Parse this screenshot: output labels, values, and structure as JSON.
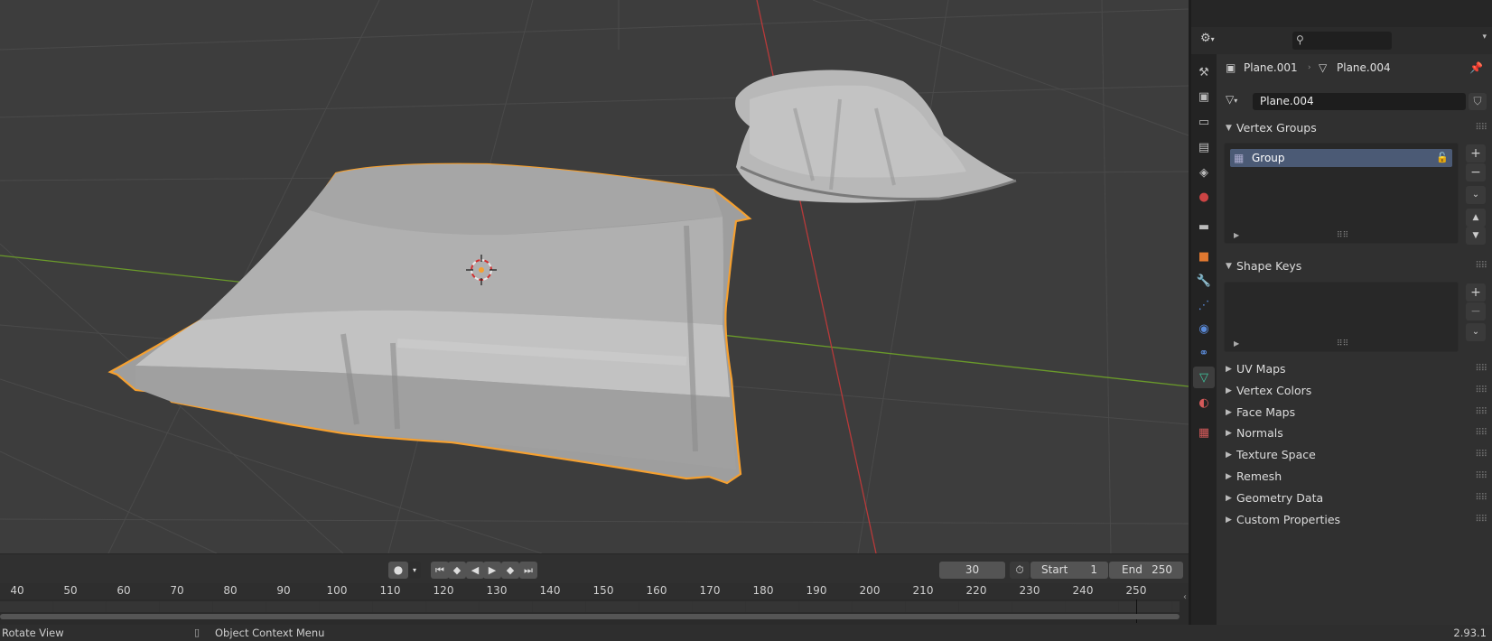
{
  "header": {
    "search_placeholder": ""
  },
  "breadcrumb": {
    "object": "Plane.001",
    "mesh": "Plane.004"
  },
  "datablock": {
    "name": "Plane.004"
  },
  "panels": {
    "vertex_groups": {
      "title": "Vertex Groups",
      "items": [
        "Group"
      ]
    },
    "shape_keys": {
      "title": "Shape Keys"
    },
    "collapsed": [
      "UV Maps",
      "Vertex Colors",
      "Face Maps",
      "Normals",
      "Texture Space",
      "Remesh",
      "Geometry Data",
      "Custom Properties"
    ]
  },
  "timeline": {
    "current_frame": "30",
    "start_label": "Start",
    "start_value": "1",
    "end_label": "End",
    "end_value": "250",
    "ruler": [
      "40",
      "50",
      "60",
      "70",
      "80",
      "90",
      "100",
      "110",
      "120",
      "130",
      "140",
      "150",
      "160",
      "170",
      "180",
      "190",
      "200",
      "210",
      "220",
      "230",
      "240",
      "250"
    ]
  },
  "statusbar": {
    "left": "Rotate View",
    "middle": "Object Context Menu",
    "version": "2.93.1"
  },
  "colors": {
    "selection_outline": "#f5a030",
    "x_axis": "#b83a3a",
    "y_axis": "#6a9a2a",
    "active_list_row": "#4b5a75"
  },
  "icons": {
    "tabs": [
      "tool-icon",
      "render-icon",
      "output-icon",
      "view-layer-icon",
      "scene-icon",
      "world-icon",
      "collection-icon",
      "object-icon",
      "modifier-icon",
      "particles-icon",
      "physics-icon",
      "constraints-icon",
      "mesh-data-icon",
      "material-icon",
      "texture-icon"
    ]
  }
}
